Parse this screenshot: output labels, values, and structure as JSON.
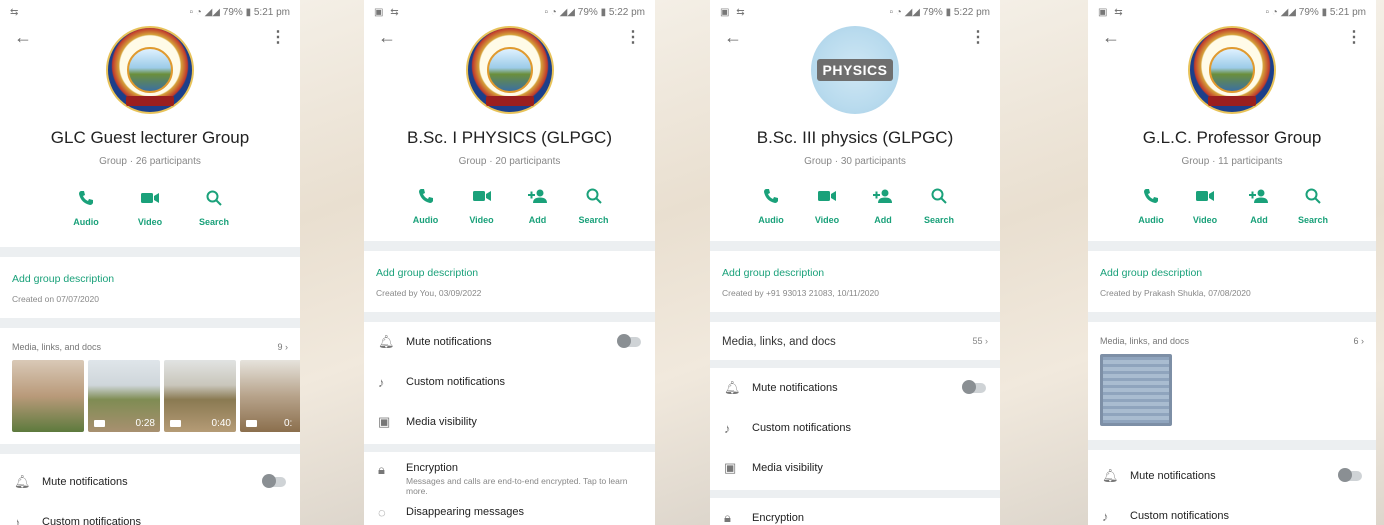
{
  "status": {
    "p1": {
      "battery": "79%",
      "time": "5:21 pm"
    },
    "p2": {
      "battery": "79%",
      "time": "5:22 pm"
    },
    "p3": {
      "battery": "79%",
      "time": "5:22 pm"
    },
    "p4": {
      "battery": "79%",
      "time": "5:21 pm"
    }
  },
  "labels": {
    "audio": "Audio",
    "video": "Video",
    "add": "Add",
    "search": "Search"
  },
  "colors": {
    "accent": "#1aa17a",
    "divider_band": "#eceff1"
  },
  "phones": [
    {
      "name": "GLC Guest lecturer Group",
      "sub": "Group · 26 participants",
      "add_desc": "Add group description",
      "created": "Created on 07/07/2020",
      "media_label": "Media, links, and docs",
      "media_count": "9 ›",
      "durations": [
        "0:28",
        "0:40",
        "0:"
      ],
      "mute": "Mute notifications",
      "custom": "Custom notifications"
    },
    {
      "name": "B.Sc. I PHYSICS (GLPGC)",
      "sub": "Group · 20 participants",
      "add_desc": "Add group description",
      "created": "Created by You, 03/09/2022",
      "mute": "Mute notifications",
      "custom": "Custom notifications",
      "visibility": "Media visibility",
      "encryption": "Encryption",
      "encryption_sub": "Messages and calls are end-to-end encrypted. Tap to learn more.",
      "disappearing": "Disappearing messages"
    },
    {
      "name": "B.Sc. III physics (GLPGC)",
      "sub": "Group · 30 participants",
      "avatar_text": "PHYSICS",
      "add_desc": "Add group description",
      "created": "Created by +91 93013 21083, 10/11/2020",
      "media_label": "Media, links, and docs",
      "media_count": "55 ›",
      "mute": "Mute notifications",
      "custom": "Custom notifications",
      "visibility": "Media visibility",
      "encryption": "Encryption"
    },
    {
      "name": "G.L.C. Professor Group",
      "sub": "Group · 11 participants",
      "add_desc": "Add group description",
      "created": "Created by Prakash Shukla, 07/08/2020",
      "media_label": "Media, links, and docs",
      "media_count": "6 ›",
      "mute": "Mute notifications",
      "custom": "Custom notifications"
    }
  ]
}
